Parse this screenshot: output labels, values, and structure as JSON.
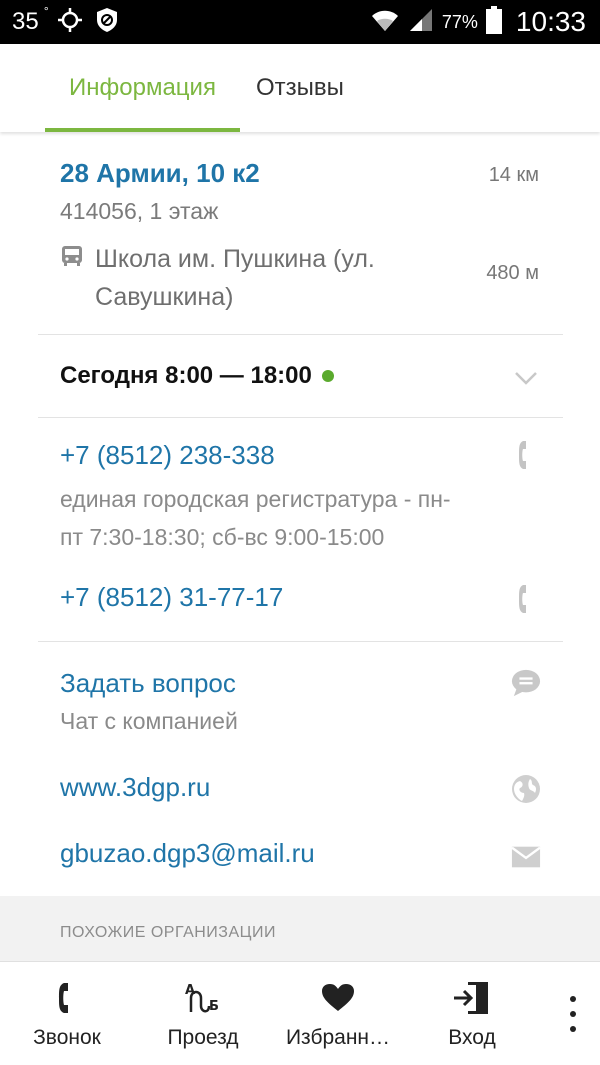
{
  "status_bar": {
    "temperature": "35",
    "degree": "°",
    "battery_pct": "77%",
    "time": "10:33"
  },
  "tabs": [
    {
      "label": "Информация",
      "active": true
    },
    {
      "label": "Отзывы",
      "active": false
    }
  ],
  "address": {
    "street": "28 Армии, 10 к2",
    "details": "414056, 1 этаж",
    "distance": "14 км",
    "stop_line1": "Школа им. Пушкина (ул.",
    "stop_line2": "Савушкина)",
    "stop_distance": "480 м"
  },
  "hours": {
    "text": "Сегодня 8:00 — 18:00",
    "status_color": "#5aaa2d"
  },
  "phones": [
    {
      "number": "+7 (8512) 238-338",
      "note_line1": "единая городская регистратура - пн-",
      "note_line2": "пт 7:30-18:30; сб-вс 9:00-15:00"
    },
    {
      "number": "+7 (8512) 31-77-17"
    }
  ],
  "chat": {
    "label": "Задать вопрос",
    "sub": "Чат с компанией"
  },
  "website": "www.3dgp.ru",
  "email": "gbuzao.dgp3@mail.ru",
  "similar_header": "ПОХОЖИЕ ОРГАНИЗАЦИИ",
  "toolbar": {
    "call": "Звонок",
    "route": "Проезд",
    "favorite": "Избранн…",
    "login": "Вход"
  },
  "colors": {
    "accent_green": "#7cb740",
    "link_blue": "#1f75a8"
  }
}
